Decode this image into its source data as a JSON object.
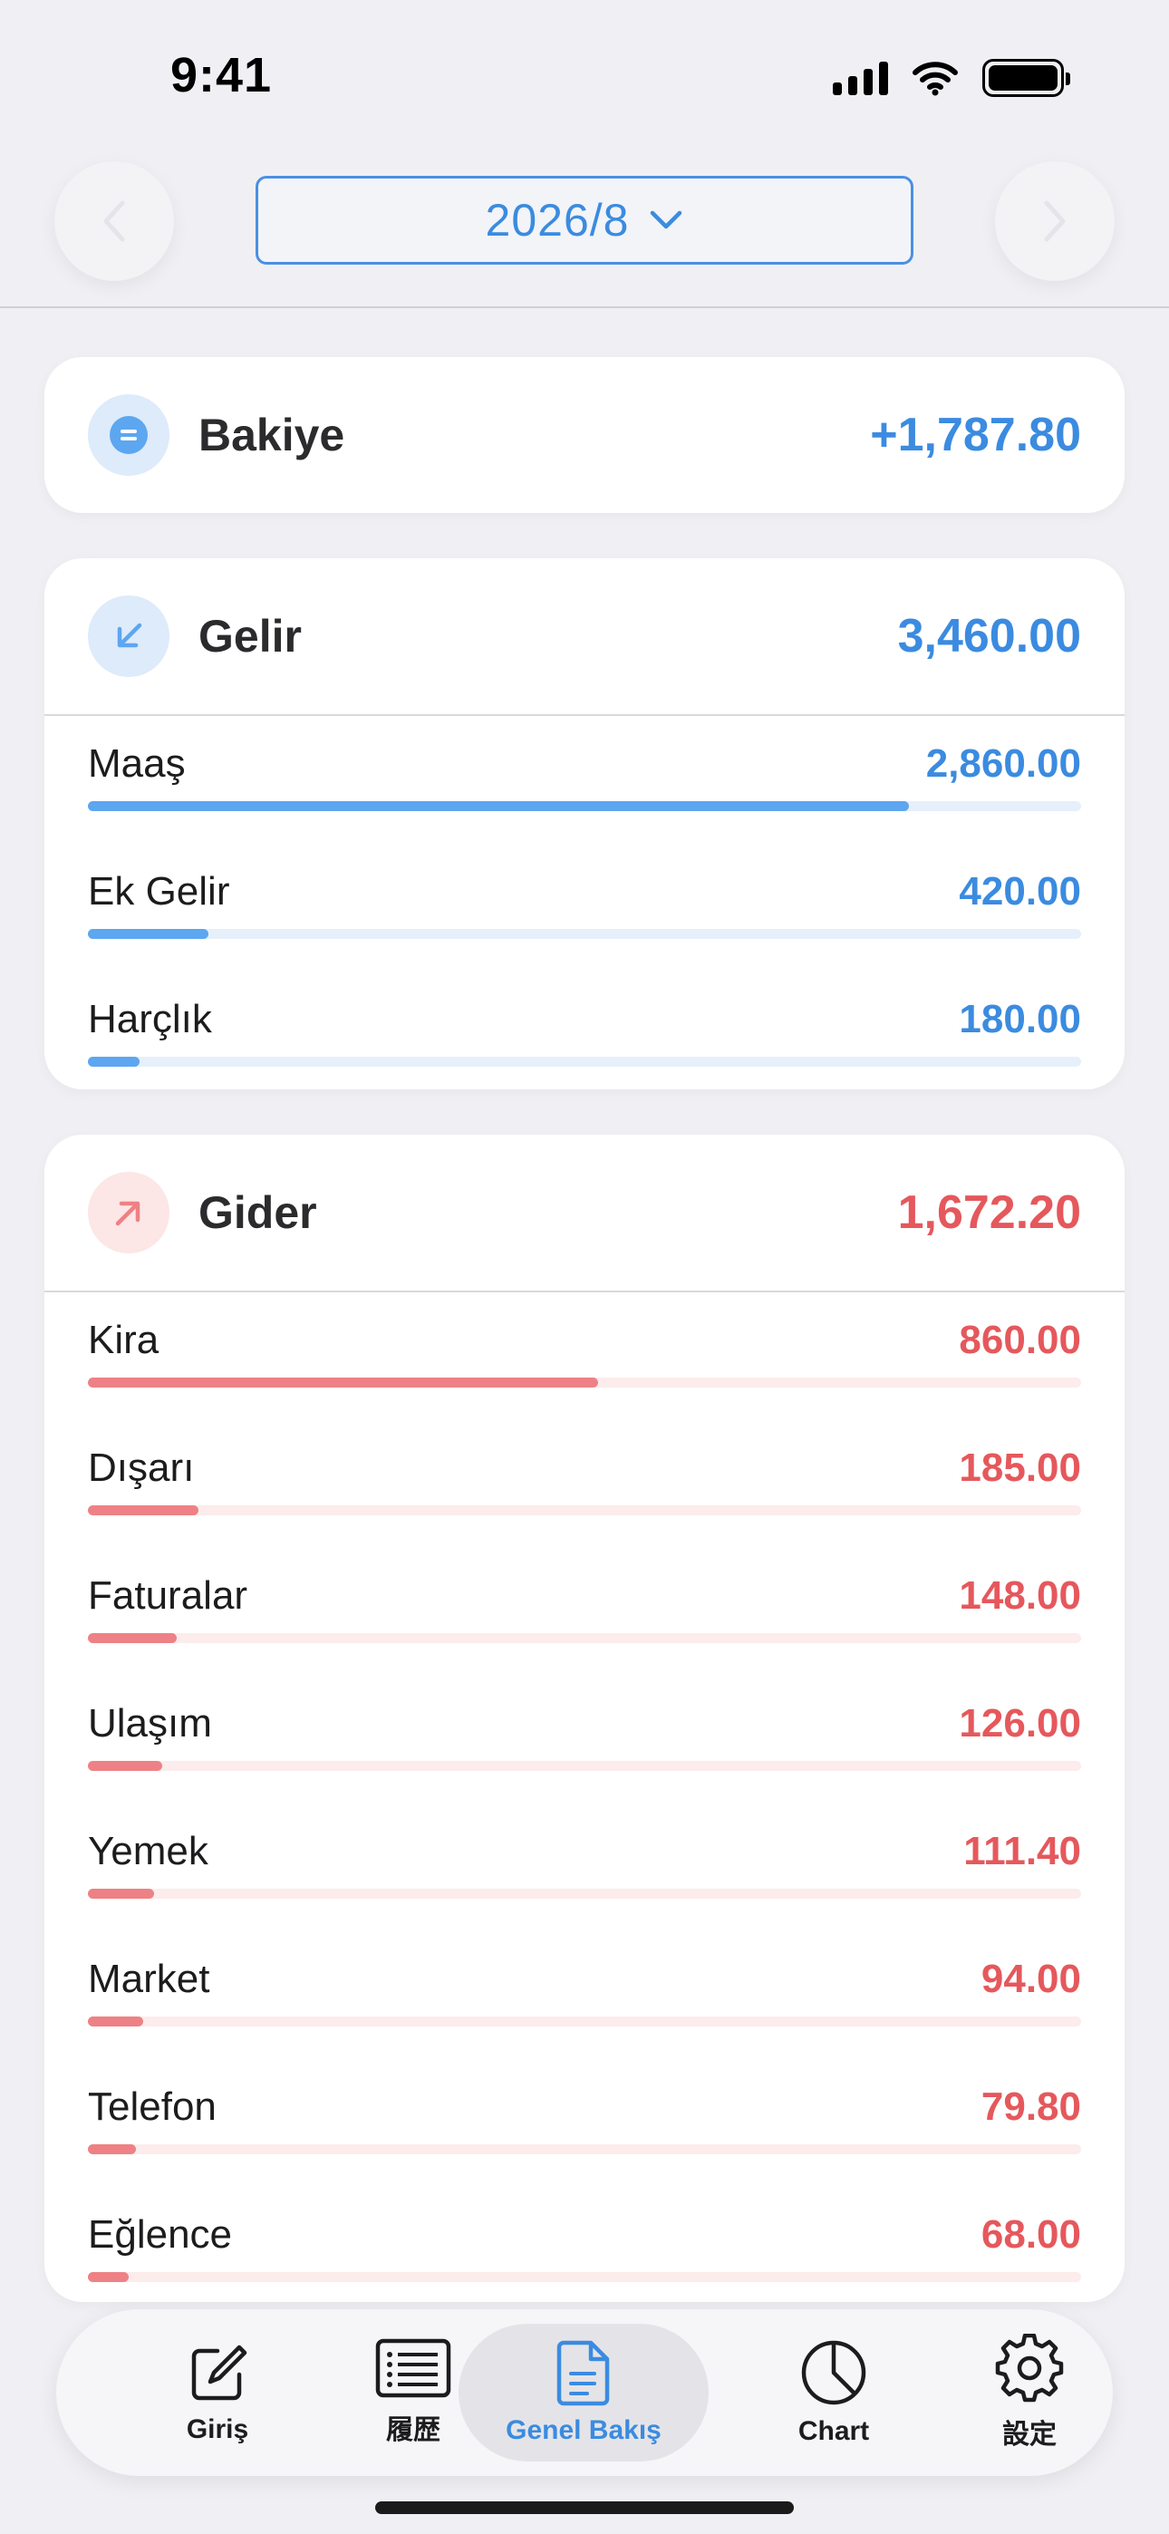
{
  "status_bar": {
    "time": "9:41"
  },
  "header": {
    "month": "2026/8"
  },
  "balance": {
    "title": "Bakiye",
    "amount": "+1,787.80"
  },
  "income": {
    "title": "Gelir",
    "total": "3,460.00",
    "items": [
      {
        "label": "Maaş",
        "value": "2,860.00",
        "share": 0.827
      },
      {
        "label": "Ek Gelir",
        "value": "420.00",
        "share": 0.121
      },
      {
        "label": "Harçlık",
        "value": "180.00",
        "share": 0.052
      }
    ]
  },
  "expense": {
    "title": "Gider",
    "total": "1,672.20",
    "items": [
      {
        "label": "Kira",
        "value": "860.00",
        "share": 0.514
      },
      {
        "label": "Dışarı",
        "value": "185.00",
        "share": 0.111
      },
      {
        "label": "Faturalar",
        "value": "148.00",
        "share": 0.089
      },
      {
        "label": "Ulaşım",
        "value": "126.00",
        "share": 0.075
      },
      {
        "label": "Yemek",
        "value": "111.40",
        "share": 0.067
      },
      {
        "label": "Market",
        "value": "94.00",
        "share": 0.056
      },
      {
        "label": "Telefon",
        "value": "79.80",
        "share": 0.048
      },
      {
        "label": "Eğlence",
        "value": "68.00",
        "share": 0.041
      }
    ]
  },
  "tabs": [
    {
      "label": "Giriş",
      "icon": "edit-icon"
    },
    {
      "label": "履歴",
      "icon": "list-icon"
    },
    {
      "label": "Genel Bakış",
      "icon": "document-icon",
      "active": true
    },
    {
      "label": "Chart",
      "icon": "pie-chart-icon"
    },
    {
      "label": "設定",
      "icon": "gear-icon"
    }
  ],
  "colors": {
    "accent_blue": "#3B8BE0",
    "accent_red": "#E5585C",
    "background": "#F0F0F4"
  }
}
